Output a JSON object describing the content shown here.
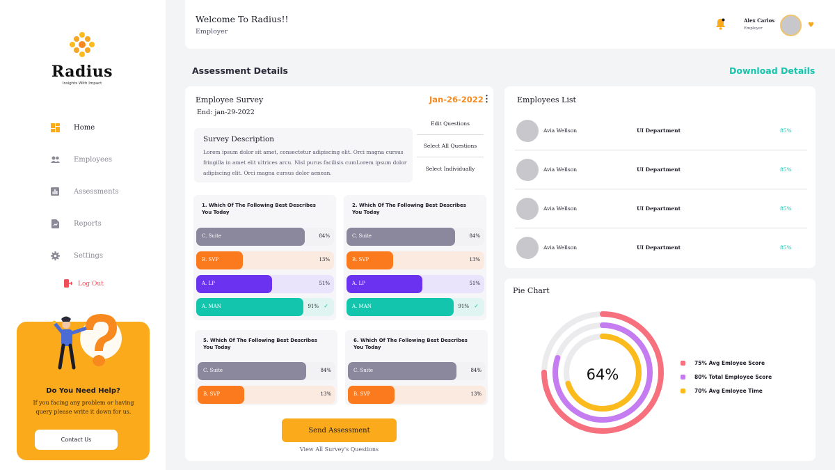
{
  "brand": {
    "name": "Radius",
    "tagline": "Insights With Impact"
  },
  "nav": [
    {
      "label": "Home",
      "icon": "dashboard-icon",
      "active": true
    },
    {
      "label": "Employees",
      "icon": "people-icon",
      "active": false
    },
    {
      "label": "Assessments",
      "icon": "bar-chart-icon",
      "active": false
    },
    {
      "label": "Reports",
      "icon": "report-icon",
      "active": false
    },
    {
      "label": "Settings",
      "icon": "gear-icon",
      "active": false
    }
  ],
  "logout_label": "Log Out",
  "help": {
    "title": "Do You Need Help?",
    "text": "If you facing any problem or having query please write it down for us.",
    "button": "Contact Us"
  },
  "header": {
    "welcome": "Welcome To Radius!!",
    "role": "Employer",
    "user_name": "Alex Carlos",
    "user_role": "Employer"
  },
  "section_title": "Assessment Details",
  "download_label": "Download Details",
  "survey": {
    "title": "Employee Survey",
    "end": "End: jan-29-2022",
    "date": "Jan-26-2022",
    "desc_title": "Survey Description",
    "desc_text": "Lorem ipsum dolor sit amet, consectetur adipiscing elit. Orci magna cursus fringilla in amet elit ultrices arcu. Nisl purus facilisis cumLorem ipsum dolor adipiscing elit. Orci magna cursus dolor aenean.",
    "menu": [
      "Edit Questions",
      "Select All Questions",
      "Select Individually"
    ],
    "questions": [
      {
        "title": "1.  Which Of The Following Best Describes You Today",
        "options": [
          {
            "label": "C. Suite",
            "pct": "84%",
            "value": 0.79,
            "fill": "#8b879d",
            "track": "#f2f1f4",
            "checked": false
          },
          {
            "label": "B. SVP",
            "pct": "13%",
            "value": 0.34,
            "fill": "#fb7a1e",
            "track": "#fbeae0",
            "checked": false
          },
          {
            "label": "A. LP",
            "pct": "51%",
            "value": 0.55,
            "fill": "#6b33f0",
            "track": "#e9e4fb",
            "checked": false
          },
          {
            "label": "A. MAN",
            "pct": "91%",
            "value": 0.78,
            "fill": "#14c5ad",
            "track": "#e0f5f1",
            "checked": true
          }
        ]
      },
      {
        "title": "2. Which Of The Following Best Describes You Today",
        "options": [
          {
            "label": "C. Suite",
            "pct": "84%",
            "value": 0.79,
            "fill": "#8b879d",
            "track": "#f2f1f4",
            "checked": false
          },
          {
            "label": "B. SVP",
            "pct": "13%",
            "value": 0.34,
            "fill": "#fb7a1e",
            "track": "#fbeae0",
            "checked": false
          },
          {
            "label": "A. LP",
            "pct": "51%",
            "value": 0.55,
            "fill": "#6b33f0",
            "track": "#e9e4fb",
            "checked": false
          },
          {
            "label": "A. MAN",
            "pct": "91%",
            "value": 0.78,
            "fill": "#14c5ad",
            "track": "#e0f5f1",
            "checked": true
          }
        ]
      },
      {
        "title": "5.  Which Of The Following Best Describes You Today",
        "options": [
          {
            "label": "C. Suite",
            "pct": "84%",
            "value": 0.79,
            "fill": "#8b879d",
            "track": "#f2f1f4",
            "checked": false
          },
          {
            "label": "B. SVP",
            "pct": "13%",
            "value": 0.34,
            "fill": "#fb7a1e",
            "track": "#fbeae0",
            "checked": false
          }
        ]
      },
      {
        "title": "6.  Which Of The Following Best Describes You Today",
        "options": [
          {
            "label": "C. Suite",
            "pct": "84%",
            "value": 0.79,
            "fill": "#8b879d",
            "track": "#f2f1f4",
            "checked": false
          },
          {
            "label": "B. SVP",
            "pct": "13%",
            "value": 0.34,
            "fill": "#fb7a1e",
            "track": "#fbeae0",
            "checked": false
          }
        ]
      }
    ],
    "send_button": "Send Assessment",
    "view_all": "View All Survey's Questions"
  },
  "employees": {
    "title": "Employees List",
    "rows": [
      {
        "name": "Avia Wellson",
        "dept": "UI Department",
        "pct": "85%"
      },
      {
        "name": "Avia Wellson",
        "dept": "UI Department",
        "pct": "85%"
      },
      {
        "name": "Avia Wellson",
        "dept": "UI Department",
        "pct": "85%"
      },
      {
        "name": "Avia Wellson",
        "dept": "UI Department",
        "pct": "85%"
      }
    ]
  },
  "pie": {
    "title": "Pie Chart",
    "center": "64%",
    "legend": [
      {
        "label": "75% Avg Emloyee Score",
        "color": "#f7707e"
      },
      {
        "label": "80% Total Employee Score",
        "color": "#c47cf0"
      },
      {
        "label": "70% Avg Emloyee Time",
        "color": "#fbbb1c"
      }
    ]
  },
  "chart_data": {
    "type": "pie",
    "title": "Pie Chart",
    "center_label": "64%",
    "series": [
      {
        "name": "75% Avg Emloyee Score",
        "value": 75,
        "color": "#f7707e"
      },
      {
        "name": "80% Total Employee Score",
        "value": 80,
        "color": "#c47cf0"
      },
      {
        "name": "70% Avg Emloyee Time",
        "value": 70,
        "color": "#fbbb1c"
      }
    ],
    "legend": "right"
  }
}
